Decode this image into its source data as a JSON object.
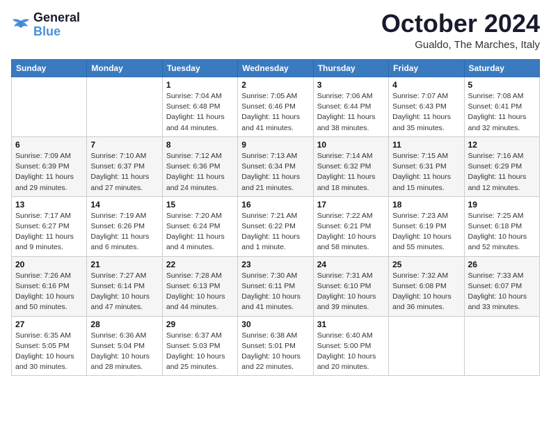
{
  "header": {
    "logo_line1": "General",
    "logo_line2": "Blue",
    "month": "October 2024",
    "location": "Gualdo, The Marches, Italy"
  },
  "weekdays": [
    "Sunday",
    "Monday",
    "Tuesday",
    "Wednesday",
    "Thursday",
    "Friday",
    "Saturday"
  ],
  "weeks": [
    [
      {
        "day": "",
        "info": ""
      },
      {
        "day": "",
        "info": ""
      },
      {
        "day": "1",
        "info": "Sunrise: 7:04 AM\nSunset: 6:48 PM\nDaylight: 11 hours and 44 minutes."
      },
      {
        "day": "2",
        "info": "Sunrise: 7:05 AM\nSunset: 6:46 PM\nDaylight: 11 hours and 41 minutes."
      },
      {
        "day": "3",
        "info": "Sunrise: 7:06 AM\nSunset: 6:44 PM\nDaylight: 11 hours and 38 minutes."
      },
      {
        "day": "4",
        "info": "Sunrise: 7:07 AM\nSunset: 6:43 PM\nDaylight: 11 hours and 35 minutes."
      },
      {
        "day": "5",
        "info": "Sunrise: 7:08 AM\nSunset: 6:41 PM\nDaylight: 11 hours and 32 minutes."
      }
    ],
    [
      {
        "day": "6",
        "info": "Sunrise: 7:09 AM\nSunset: 6:39 PM\nDaylight: 11 hours and 29 minutes."
      },
      {
        "day": "7",
        "info": "Sunrise: 7:10 AM\nSunset: 6:37 PM\nDaylight: 11 hours and 27 minutes."
      },
      {
        "day": "8",
        "info": "Sunrise: 7:12 AM\nSunset: 6:36 PM\nDaylight: 11 hours and 24 minutes."
      },
      {
        "day": "9",
        "info": "Sunrise: 7:13 AM\nSunset: 6:34 PM\nDaylight: 11 hours and 21 minutes."
      },
      {
        "day": "10",
        "info": "Sunrise: 7:14 AM\nSunset: 6:32 PM\nDaylight: 11 hours and 18 minutes."
      },
      {
        "day": "11",
        "info": "Sunrise: 7:15 AM\nSunset: 6:31 PM\nDaylight: 11 hours and 15 minutes."
      },
      {
        "day": "12",
        "info": "Sunrise: 7:16 AM\nSunset: 6:29 PM\nDaylight: 11 hours and 12 minutes."
      }
    ],
    [
      {
        "day": "13",
        "info": "Sunrise: 7:17 AM\nSunset: 6:27 PM\nDaylight: 11 hours and 9 minutes."
      },
      {
        "day": "14",
        "info": "Sunrise: 7:19 AM\nSunset: 6:26 PM\nDaylight: 11 hours and 6 minutes."
      },
      {
        "day": "15",
        "info": "Sunrise: 7:20 AM\nSunset: 6:24 PM\nDaylight: 11 hours and 4 minutes."
      },
      {
        "day": "16",
        "info": "Sunrise: 7:21 AM\nSunset: 6:22 PM\nDaylight: 11 hours and 1 minute."
      },
      {
        "day": "17",
        "info": "Sunrise: 7:22 AM\nSunset: 6:21 PM\nDaylight: 10 hours and 58 minutes."
      },
      {
        "day": "18",
        "info": "Sunrise: 7:23 AM\nSunset: 6:19 PM\nDaylight: 10 hours and 55 minutes."
      },
      {
        "day": "19",
        "info": "Sunrise: 7:25 AM\nSunset: 6:18 PM\nDaylight: 10 hours and 52 minutes."
      }
    ],
    [
      {
        "day": "20",
        "info": "Sunrise: 7:26 AM\nSunset: 6:16 PM\nDaylight: 10 hours and 50 minutes."
      },
      {
        "day": "21",
        "info": "Sunrise: 7:27 AM\nSunset: 6:14 PM\nDaylight: 10 hours and 47 minutes."
      },
      {
        "day": "22",
        "info": "Sunrise: 7:28 AM\nSunset: 6:13 PM\nDaylight: 10 hours and 44 minutes."
      },
      {
        "day": "23",
        "info": "Sunrise: 7:30 AM\nSunset: 6:11 PM\nDaylight: 10 hours and 41 minutes."
      },
      {
        "day": "24",
        "info": "Sunrise: 7:31 AM\nSunset: 6:10 PM\nDaylight: 10 hours and 39 minutes."
      },
      {
        "day": "25",
        "info": "Sunrise: 7:32 AM\nSunset: 6:08 PM\nDaylight: 10 hours and 36 minutes."
      },
      {
        "day": "26",
        "info": "Sunrise: 7:33 AM\nSunset: 6:07 PM\nDaylight: 10 hours and 33 minutes."
      }
    ],
    [
      {
        "day": "27",
        "info": "Sunrise: 6:35 AM\nSunset: 5:05 PM\nDaylight: 10 hours and 30 minutes."
      },
      {
        "day": "28",
        "info": "Sunrise: 6:36 AM\nSunset: 5:04 PM\nDaylight: 10 hours and 28 minutes."
      },
      {
        "day": "29",
        "info": "Sunrise: 6:37 AM\nSunset: 5:03 PM\nDaylight: 10 hours and 25 minutes."
      },
      {
        "day": "30",
        "info": "Sunrise: 6:38 AM\nSunset: 5:01 PM\nDaylight: 10 hours and 22 minutes."
      },
      {
        "day": "31",
        "info": "Sunrise: 6:40 AM\nSunset: 5:00 PM\nDaylight: 10 hours and 20 minutes."
      },
      {
        "day": "",
        "info": ""
      },
      {
        "day": "",
        "info": ""
      }
    ]
  ]
}
